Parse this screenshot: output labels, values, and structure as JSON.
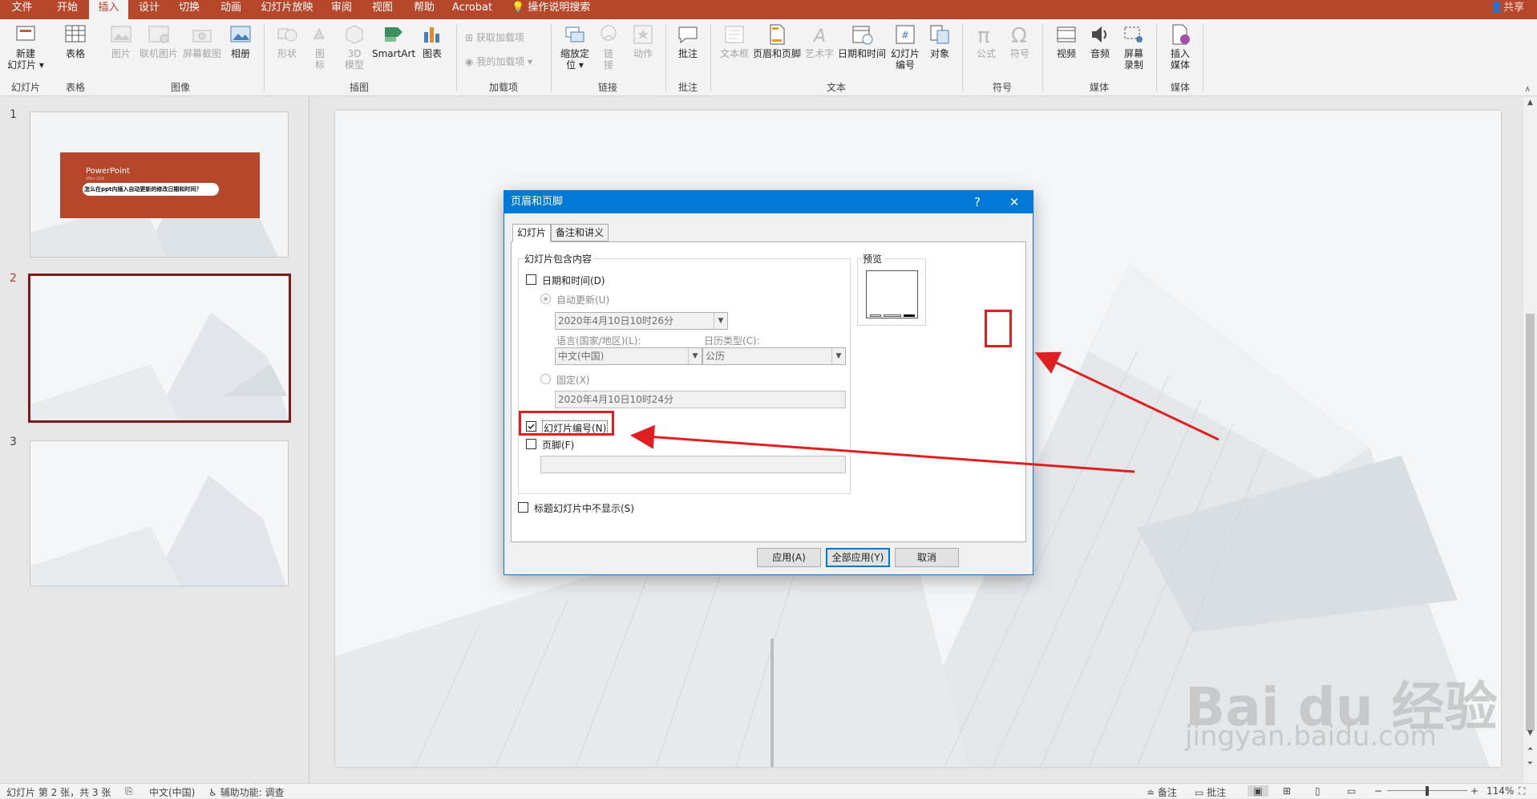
{
  "ribbon_tabs": [
    "文件",
    "开始",
    "插入",
    "设计",
    "切换",
    "动画",
    "幻灯片放映",
    "审阅",
    "视图",
    "帮助",
    "Acrobat"
  ],
  "tell_me": "操作说明搜索",
  "share": "共享",
  "ribbon": {
    "new_slide": "新建\n幻灯片 ▾",
    "table": "表格",
    "picture": "图片",
    "online_picture": "联机图片",
    "screenshot": "屏幕截图",
    "album": "相册",
    "shapes": "形状",
    "icons": "图\n标",
    "model3d": "3D\n模型",
    "smartart": "SmartArt",
    "chart": "图表",
    "get_addins": "获取加载项",
    "my_addins": "我的加载项",
    "zoom": "缩放定\n位 ▾",
    "link": "链\n接",
    "action": "动作",
    "comment": "批注",
    "textbox": "文本框",
    "header_footer": "页眉和页脚",
    "wordart": "艺术字",
    "datetime": "日期和时间",
    "slide_number": "幻灯片\n编号",
    "object": "对象",
    "equation": "公式",
    "symbol": "符号",
    "video": "视频",
    "audio": "音频",
    "screen_record": "屏幕\n录制",
    "insert_media": "插入\n媒体",
    "groups": {
      "slides": "幻灯片",
      "tables": "表格",
      "images": "图像",
      "illustrations": "插图",
      "addins": "加载项",
      "links": "链接",
      "comments": "批注",
      "text": "文本",
      "symbols": "符号",
      "media": "媒体",
      "media2": "媒体"
    }
  },
  "thumbnails": [
    {
      "num": "1",
      "title": "PowerPoint",
      "subtitle": "Office 2016",
      "caption": "怎么在ppt内插入自动更新的修改日期和时间？"
    },
    {
      "num": "2"
    },
    {
      "num": "3"
    }
  ],
  "dialog": {
    "title": "页眉和页脚",
    "help": "?",
    "close": "✕",
    "tabs": [
      "幻灯片",
      "备注和讲义"
    ],
    "group_label": "幻灯片包含内容",
    "datetime": "日期和时间(D)",
    "auto_update": "自动更新(U)",
    "auto_value": "2020年4月10日10时26分",
    "language_label": "语言(国家/地区)(L):",
    "language_value": "中文(中国)",
    "calendar_label": "日历类型(C):",
    "calendar_value": "公历",
    "fixed": "固定(X)",
    "fixed_value": "2020年4月10日10时24分",
    "slide_number": "幻灯片编号(N)",
    "footer": "页脚(F)",
    "footer_value": "",
    "dont_show_title": "标题幻灯片中不显示(S)",
    "preview": "预览",
    "apply": "应用(A)",
    "apply_all": "全部应用(Y)",
    "cancel": "取消",
    "checked": {
      "datetime": false,
      "slide_number": true,
      "footer": false,
      "dont_show_title": false
    }
  },
  "status": {
    "slide_info": "幻灯片 第 2 张，共 3 张",
    "language": "中文(中国)",
    "accessibility": "辅助功能: 调查",
    "notes": "备注",
    "comments": "批注",
    "zoom": "114%"
  },
  "watermark": {
    "main": "Bai du 经验",
    "sub": "jingyan.baidu.com"
  }
}
